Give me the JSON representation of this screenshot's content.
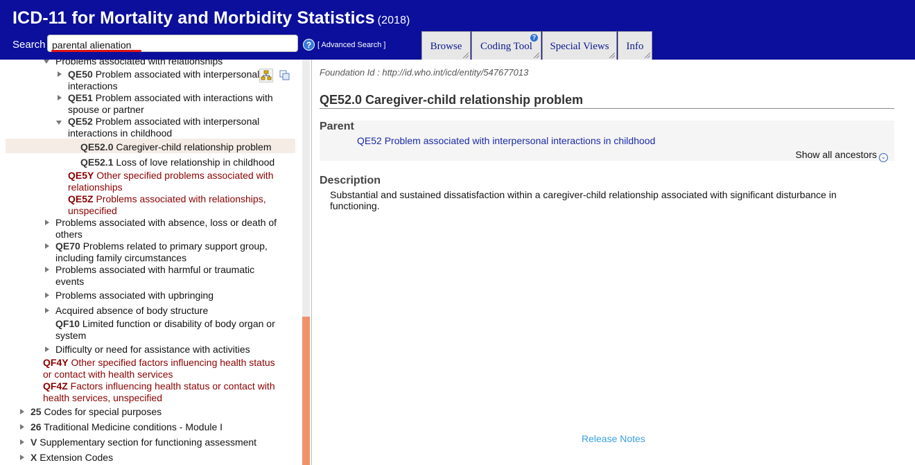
{
  "header": {
    "title": "ICD-11 for Mortality and Morbidity Statistics",
    "year": "(2018)",
    "search_label": "Search",
    "search_value": "parental alienation",
    "advanced_search": "[ Advanced Search ]",
    "help_glyph": "?",
    "tabs": [
      "Browse",
      "Coding Tool",
      "Special Views",
      "Info"
    ],
    "coding_tool_badge": "?"
  },
  "tree": {
    "rows": [
      {
        "code": "",
        "text": "Problems associated with relationships"
      },
      {
        "code": "QE50",
        "text": " Problem associated with interpersonal",
        "cont": "interactions"
      },
      {
        "code": "QE51",
        "text": " Problem associated with interactions with",
        "cont": "spouse or partner"
      },
      {
        "code": "QE52",
        "text": " Problem associated with interpersonal",
        "cont": "interactions in childhood"
      },
      {
        "code": "QE52.0",
        "text": " Caregiver-child relationship problem"
      },
      {
        "code": "QE52.1",
        "text": " Loss of love relationship in childhood"
      },
      {
        "code": "QE5Y",
        "text": " Other specified problems associated with",
        "cont": "relationships"
      },
      {
        "code": "QE5Z",
        "text": " Problems associated with relationships,",
        "cont": "unspecified"
      },
      {
        "code": "",
        "text": "Problems associated with absence, loss or death of",
        "cont": "others"
      },
      {
        "code": "QE70",
        "text": " Problems related to primary support group,",
        "cont": "including family circumstances"
      },
      {
        "code": "",
        "text": "Problems associated with harmful or traumatic",
        "cont": "events"
      },
      {
        "code": "",
        "text": "Problems associated with upbringing"
      },
      {
        "code": "",
        "text": "Acquired absence of body structure"
      },
      {
        "code": "QF10",
        "text": " Limited function or disability of body organ or",
        "cont": "system"
      },
      {
        "code": "",
        "text": "Difficulty or need for assistance with activities"
      },
      {
        "code": "QF4Y",
        "text": " Other specified factors influencing health status",
        "cont": "or contact with health services"
      },
      {
        "code": "QF4Z",
        "text": " Factors influencing health status or contact with",
        "cont": "health services, unspecified"
      },
      {
        "code": "25",
        "text": " Codes for special purposes"
      },
      {
        "code": "26",
        "text": " Traditional Medicine conditions - Module I"
      },
      {
        "code": "V",
        "text": " Supplementary section for functioning assessment"
      },
      {
        "code": "X",
        "text": " Extension Codes"
      }
    ]
  },
  "details": {
    "foundation_id": "Foundation Id : http://id.who.int/icd/entity/547677013",
    "title": "QE52.0 Caregiver-child relationship problem",
    "parent_heading": "Parent",
    "parent_link": "QE52 Problem associated with interpersonal interactions in childhood",
    "show_ancestors": "Show all ancestors",
    "description_heading": "Description",
    "description": "Substantial and sustained dissatisfaction within a caregiver-child relationship associated with significant disturbance in functioning.",
    "release_notes": "Release Notes"
  },
  "colors": {
    "header_bg": "#0b0f9b",
    "red_text": "#8b0000",
    "link": "#1a2aa8",
    "scroll_thumb": "#f0916a",
    "selected_row": "#f5ece6"
  }
}
